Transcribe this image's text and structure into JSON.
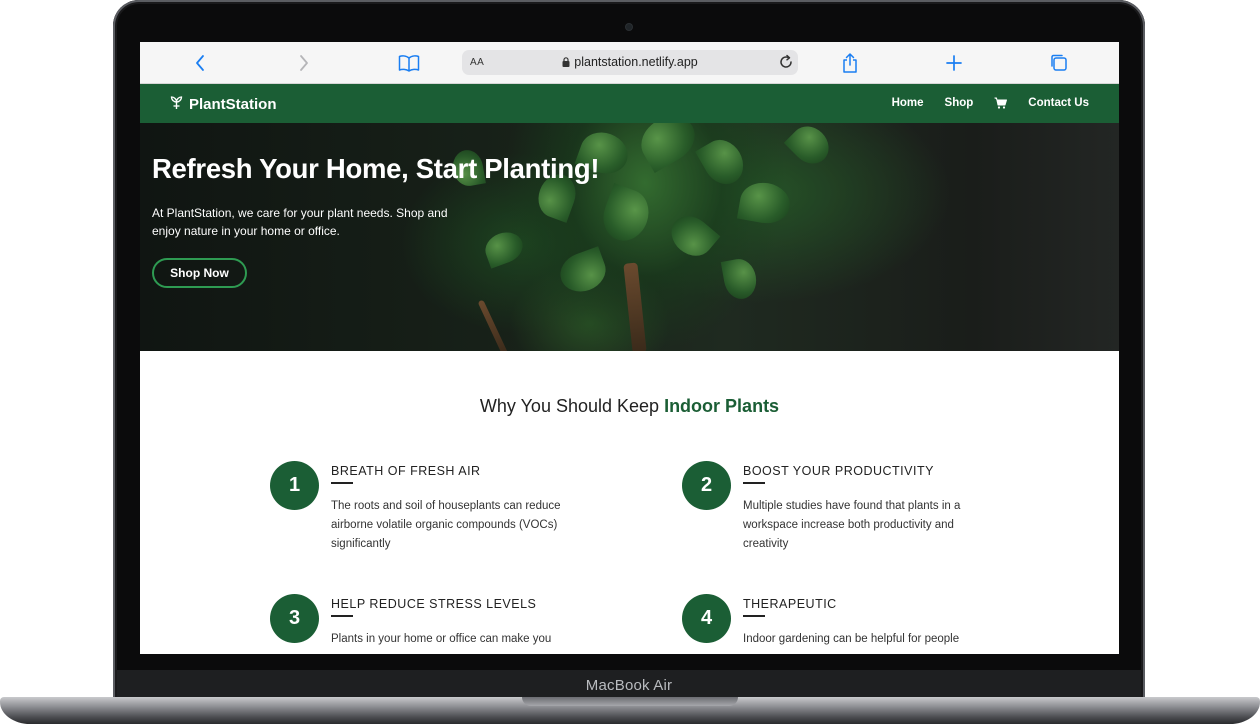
{
  "device": {
    "label": "MacBook Air"
  },
  "browser": {
    "url": "plantstation.netlify.app",
    "reader_label": "AA"
  },
  "site": {
    "brand": "PlantStation",
    "nav": {
      "home": "Home",
      "shop": "Shop",
      "contact": "Contact Us"
    }
  },
  "hero": {
    "title": "Refresh Your Home, Start Planting!",
    "text": "At PlantStation, we care for your plant needs. Shop and enjoy nature in your home or office.",
    "button": "Shop Now"
  },
  "benefits": {
    "heading_prefix": "Why You Should Keep",
    "heading_accent": "Indoor Plants",
    "items": [
      {
        "number": "1",
        "title": "BREATH OF FRESH AIR",
        "text": "The roots and soil of houseplants can reduce airborne volatile organic compounds (VOCs) significantly"
      },
      {
        "number": "2",
        "title": "BOOST YOUR PRODUCTIVITY",
        "text": "Multiple studies have found that plants in a workspace increase both productivity and creativity"
      },
      {
        "number": "3",
        "title": "HELP REDUCE STRESS LEVELS",
        "text": "Plants in your home or office can make you"
      },
      {
        "number": "4",
        "title": "THERAPEUTIC",
        "text": "Indoor gardening can be helpful for people"
      }
    ]
  },
  "colors": {
    "brand_green": "#1b5e35",
    "button_border": "#2e9b52",
    "safari_blue": "#1a7ef2"
  },
  "icons": [
    "back-icon",
    "forward-icon",
    "bookmarks-icon",
    "lock-icon",
    "reload-icon",
    "share-icon",
    "new-tab-icon",
    "tabs-icon",
    "plant-logo-icon",
    "cart-icon"
  ]
}
